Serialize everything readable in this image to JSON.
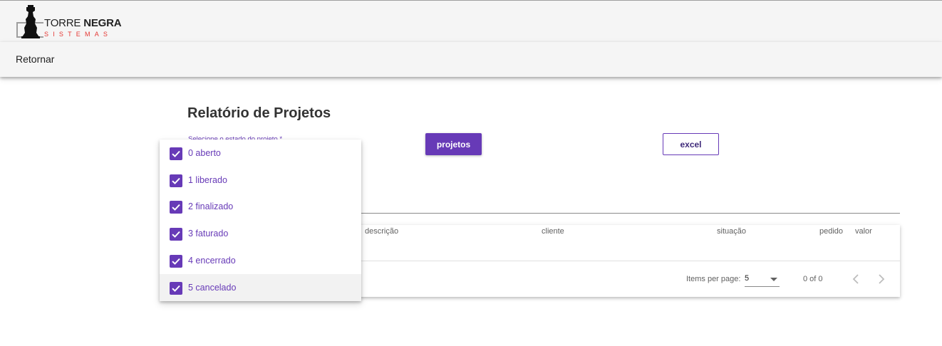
{
  "logo": {
    "word_regular": "TORRE ",
    "word_bold": "NEGRA",
    "tagline": "SISTEMAS"
  },
  "toolbar": {
    "back_label": "Retornar"
  },
  "page": {
    "title": "Relatório de Projetos",
    "select_label": "Selecione o estado do projeto *"
  },
  "actions": {
    "projetos_label": "projetos",
    "excel_label": "excel"
  },
  "dropdown": {
    "options": [
      {
        "label": "0 aberto",
        "checked": true
      },
      {
        "label": "1 liberado",
        "checked": true
      },
      {
        "label": "2 finalizado",
        "checked": true
      },
      {
        "label": "3 faturado",
        "checked": true
      },
      {
        "label": "4 encerrado",
        "checked": true
      },
      {
        "label": "5 cancelado",
        "checked": true
      }
    ]
  },
  "table": {
    "columns": [
      "descrição",
      "cliente",
      "situação",
      "pedido",
      "valor"
    ]
  },
  "paginator": {
    "items_per_page_label": "Items per page:",
    "page_size": "5",
    "range": "0 of 0"
  },
  "colors": {
    "accent": "#673ab7",
    "logo_red": "#e53935",
    "toolbar_bg": "#f5f5f5"
  },
  "icons": {
    "checkbox": "check-icon",
    "dropdown_caret": "caret-down-icon",
    "prev": "chevron-left-icon",
    "next": "chevron-right-icon"
  }
}
